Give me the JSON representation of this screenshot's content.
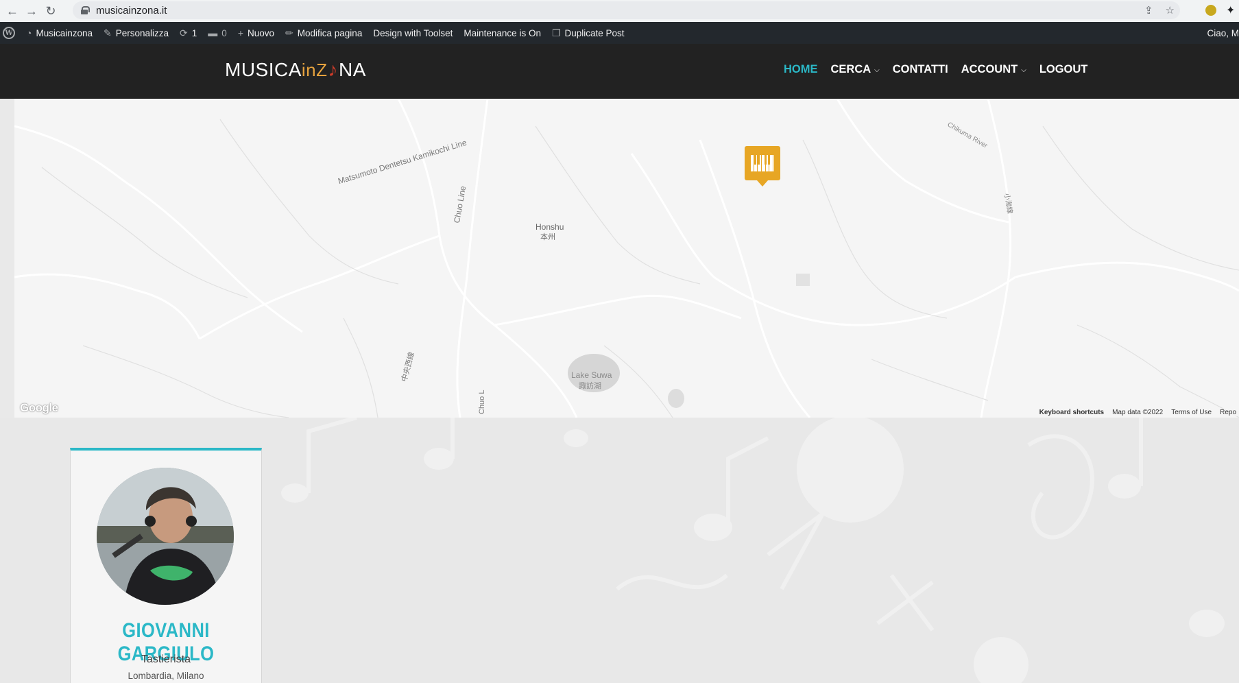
{
  "browser": {
    "url": "musicainzona.it",
    "back_icon": "arrow-left-icon",
    "forward_icon": "arrow-right-icon",
    "reload_icon": "reload-icon"
  },
  "adminbar": {
    "site_name": "Musicainzona",
    "customize": "Personalizza",
    "updates_count": "1",
    "comments_count": "0",
    "new_label": "Nuovo",
    "edit_page": "Modifica pagina",
    "toolset": "Design with Toolset",
    "maintenance": "Maintenance is On",
    "duplicate": "Duplicate Post",
    "greeting": "Ciao, M"
  },
  "site": {
    "logo_prefix": "MUSICA",
    "logo_in": "inZ",
    "logo_suffix": "NA",
    "nav": [
      {
        "label": "HOME",
        "active": true
      },
      {
        "label": "CERCA",
        "dropdown": true
      },
      {
        "label": "CONTATTI"
      },
      {
        "label": "ACCOUNT",
        "dropdown": true
      },
      {
        "label": "LOGOUT"
      }
    ]
  },
  "map": {
    "labels": {
      "line1": "Matsumoto Dentetsu Kamikochi Line",
      "chuo_line": "Chuo Line",
      "honshu": "Honshu",
      "honshu_jp": "本州",
      "chuo_jp": "中央西線",
      "chuo_v": "Chuo L",
      "lake": "Lake Suwa",
      "lake_jp": "諏訪湖",
      "chikuma": "Chikuma River",
      "jp_right": "小海線"
    },
    "google": "Google",
    "keyboard": "Keyboard shortcuts",
    "map_data": "Map data ©2022",
    "terms": "Terms of Use",
    "report": "Repo",
    "marker_icon": "piano-keys-icon"
  },
  "profile": {
    "name": "GIOVANNI GARGIULO",
    "role": "Tastierista",
    "location": "Lombardia, Milano"
  },
  "colors": {
    "accent": "#2bb8c7",
    "marker": "#e7a624",
    "header": "#222222",
    "adminbar": "#23282d"
  }
}
